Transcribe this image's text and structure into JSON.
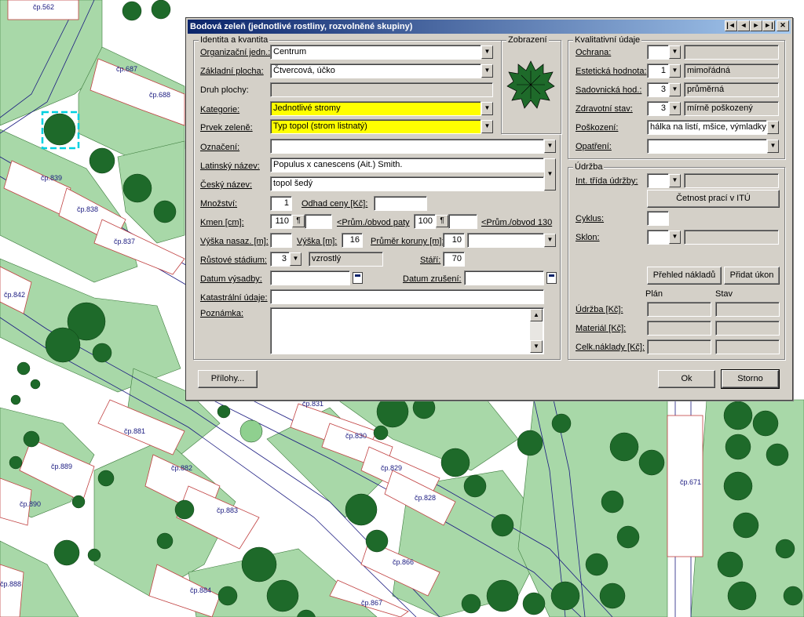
{
  "window": {
    "title": "Bodová zeleň (jednotlivé rostliny, rozvolněné skupiny)",
    "controls": [
      "|◄",
      "◄",
      "►",
      "►|",
      "✕"
    ]
  },
  "identita": {
    "title": "Identita a kvantita",
    "organizacni_label": "Organizační jedn.:",
    "organizacni_value": "Centrum",
    "zakladni_label": "Základní plocha:",
    "zakladni_value": "Čtvercová, účko",
    "druh_label": "Druh plochy:",
    "druh_value": "",
    "kategorie_label": "Kategorie:",
    "kategorie_value": "Jednotlivé stromy",
    "prvek_label": "Prvek zeleně:",
    "prvek_value": "Typ topol (strom listnatý)",
    "oznaceni_label": "Označení:",
    "oznaceni_value": "",
    "latinsky_label": "Latinský název:",
    "latinsky_value": "Populus x canescens (Ait.) Smith.",
    "cesky_label": "Český název:",
    "cesky_value": "topol šedý",
    "mnozstvi_label": "Množství:",
    "mnozstvi_value": "1",
    "odhad_label": "Odhad ceny [Kč]:",
    "odhad_value": "",
    "kmen_label": "Kmen [cm]:",
    "kmen_value": "110",
    "kmen_btn": "¶",
    "kmen_extra": "",
    "prum_paty_label": "<Prům./obvod paty",
    "prum_paty_value": "100",
    "prum_paty_btn": "¶",
    "prum_paty_extra": "",
    "prum_130_label": "<Prům./obvod 130",
    "vyska_nasaz_label": "Výška nasaz. [m]:",
    "vyska_nasaz_value": "",
    "vyska_label": "Výška [m]:",
    "vyska_value": "16",
    "prumer_koruny_label": "Průměr koruny [m]:",
    "prumer_koruny_value": "10",
    "prumer_koruny_select": "",
    "rustove_label": "Růstové stádium:",
    "rustove_value": "3",
    "rustove_text": "vzrostlý",
    "stari_label": "Stáří:",
    "stari_value": "70",
    "datum_vysadby_label": "Datum výsadby:",
    "datum_vysadby_value": "",
    "datum_zruseni_label": "Datum zrušení:",
    "datum_zruseni_value": "",
    "katastralni_label": "Katastrální údaje:",
    "katastralni_value": "",
    "poznamka_label": "Poznámka:",
    "poznamka_value": ""
  },
  "zobrazeni": {
    "title": "Zobrazení"
  },
  "kvalitativni": {
    "title": "Kvalitativní údaje",
    "ochrana_label": "Ochrana:",
    "ochrana_value": "",
    "ochrana_text": "",
    "esteticka_label": "Estetická hodnota:",
    "esteticka_value": "1",
    "esteticka_text": "mimořádná",
    "sadovnicka_label": "Sadovnická hod.:",
    "sadovnicka_value": "3",
    "sadovnicka_text": "průměrná",
    "zdravotni_label": "Zdravotní stav:",
    "zdravotni_value": "3",
    "zdravotni_text": "mírně poškozený",
    "poskozeni_label": "Poškození:",
    "poskozeni_value": "hálka na listí, mšice, výmladky",
    "opatreni_label": "Opatření:",
    "opatreni_value": ""
  },
  "udrzba": {
    "title": "Údržba",
    "int_trida_label": "Int. třída údržby:",
    "int_trida_value": "",
    "int_trida_text": "",
    "cetnost_button": "Četnost prací v ITÚ",
    "cyklus_label": "Cyklus:",
    "cyklus_value": "",
    "sklon_label": "Sklon:",
    "sklon_value": "",
    "sklon_text": "",
    "prehled_button": "Přehled nákladů",
    "pridat_button": "Přidat úkon",
    "plan_header": "Plán",
    "stav_header": "Stav",
    "udrzba_kc_label": "Údržba [Kč]:",
    "material_label": "Materiál [Kč]:",
    "celk_label": "Celk.náklady [Kč]:"
  },
  "footer": {
    "prilohy_button": "Přílohy...",
    "ok_button": "Ok",
    "storno_button": "Storno"
  },
  "map_labels": [
    "čp.562",
    "čp.687",
    "čp.688",
    "čp.839",
    "čp.838",
    "čp.837",
    "čp.842",
    "čp.831",
    "čp.830",
    "čp.829",
    "čp.828",
    "čp.881",
    "čp.889",
    "čp.882",
    "čp.883",
    "čp.890",
    "čp.888",
    "čp.884",
    "čp.866",
    "čp.867",
    "čp.671"
  ],
  "colors": {
    "title_start": "#0a246a",
    "title_end": "#a6caf0",
    "highlight": "#ffff00",
    "dialog": "#d4d0c8",
    "map_green": "#a8d8a8",
    "tree": "#1e6a2a"
  }
}
